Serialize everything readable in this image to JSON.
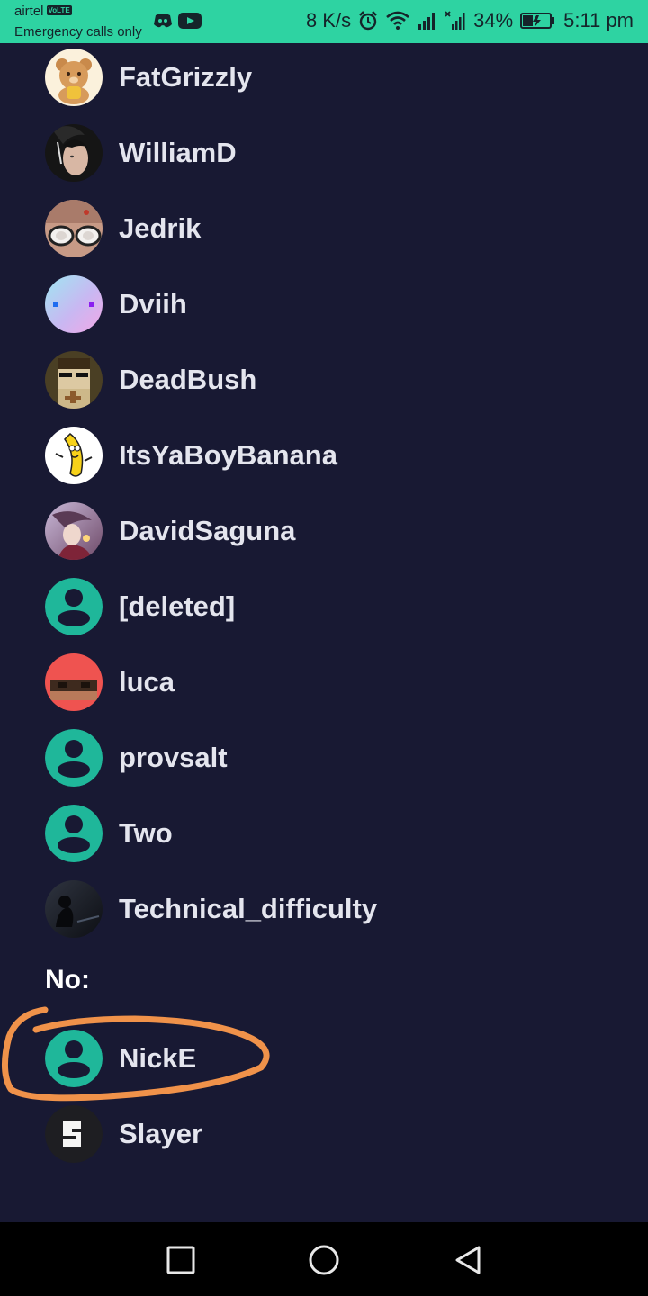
{
  "status_bar": {
    "carrier": "airtel",
    "volte_badge": "VoLTE",
    "emergency_text": "Emergency calls only",
    "speed": "8 K/s",
    "battery_percent": "34%",
    "time": "5:11 pm",
    "background_color": "#2ed3a2",
    "app_icons": [
      "discord-icon",
      "youtube-icon"
    ],
    "system_icons": [
      "alarm-icon",
      "wifi-icon",
      "signal-icon",
      "signal-no-service-icon",
      "battery-charging-icon"
    ]
  },
  "members": [
    {
      "name": "FatGrizzly",
      "avatar": "bear-avatar"
    },
    {
      "name": "WilliamD",
      "avatar": "photo-avatar"
    },
    {
      "name": "Jedrik",
      "avatar": "photo-avatar"
    },
    {
      "name": "Dviih",
      "avatar": "gradient-avatar"
    },
    {
      "name": "DeadBush",
      "avatar": "pixel-avatar"
    },
    {
      "name": "ItsYaBoyBanana",
      "avatar": "banana-avatar"
    },
    {
      "name": "DavidSaguna",
      "avatar": "art-avatar"
    },
    {
      "name": "[deleted]",
      "avatar": "default-user-avatar"
    },
    {
      "name": "luca",
      "avatar": "pixel-avatar"
    },
    {
      "name": "provsalt",
      "avatar": "default-user-avatar"
    },
    {
      "name": "Two",
      "avatar": "default-user-avatar"
    },
    {
      "name": "Technical_difficulty",
      "avatar": "dark-photo-avatar"
    }
  ],
  "section_no": {
    "label": "No:",
    "members": [
      {
        "name": "NickE",
        "avatar": "default-user-avatar",
        "highlighted": true
      },
      {
        "name": "Slayer",
        "avatar": "logo-avatar"
      }
    ]
  },
  "colors": {
    "background": "#181933",
    "default_avatar": "#1fb79a",
    "highlight_stroke": "#f0924a",
    "name_text": "#e4e5ee"
  },
  "nav_bar": {
    "buttons": [
      "recents-square-icon",
      "home-circle-icon",
      "back-triangle-icon"
    ]
  }
}
